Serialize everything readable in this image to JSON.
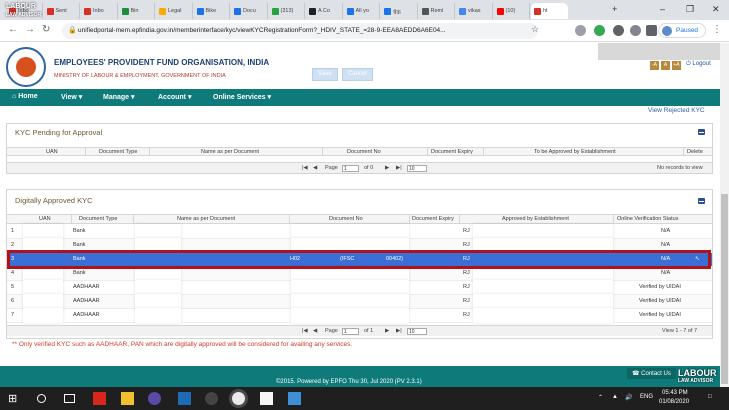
{
  "browser": {
    "tabs": [
      {
        "label": "Inbo",
        "fav": "#d93025"
      },
      {
        "label": "Sent",
        "fav": "#d93025"
      },
      {
        "label": "Inbo",
        "fav": "#d93025"
      },
      {
        "label": "Bin",
        "fav": "#1e8e3e"
      },
      {
        "label": "Legal",
        "fav": "#f9ab00"
      },
      {
        "label": "Bike",
        "fav": "#1a73e8"
      },
      {
        "label": "Docu",
        "fav": "#1a73e8"
      },
      {
        "label": "(313)",
        "fav": "#25a244"
      },
      {
        "label": "A Co",
        "fav": "#202124"
      },
      {
        "label": "All yo",
        "fav": "#1a73e8"
      },
      {
        "label": "चेक",
        "fav": "#1a73e8"
      },
      {
        "label": "Remi",
        "fav": "#555555"
      },
      {
        "label": "vikas",
        "fav": "#4285f4"
      },
      {
        "label": "(10)",
        "fav": "#ff0000"
      },
      {
        "label": "ht",
        "fav": "#d93025"
      }
    ],
    "new_tab": "+",
    "url": "unifiedportal-mem.epfindia.gov.in/memberinterface/kyc/viewKYCRegistrationForm?_HDIV_STATE_=28-9-EEA8AEDD6A6E04...",
    "profile_status": "Paused"
  },
  "header": {
    "org_name": "EMPLOYEES' PROVIDENT FUND ORGANISATION, INDIA",
    "ministry": "MINISTRY OF LABOUR & EMPLOYMENT, GOVERNMENT OF INDIA",
    "ghost_btn_1": "Save",
    "ghost_btn_2": "Cancel",
    "font_sizes": [
      "-A",
      "A",
      "+A"
    ],
    "logout": "Logout"
  },
  "nav": {
    "home": "Home",
    "view": "View",
    "manage": "Manage",
    "account": "Account",
    "online_services": "Online Services"
  },
  "view_rejected": "View Rejected KYC",
  "pending": {
    "title": "KYC Pending for Approval",
    "columns": [
      "UAN",
      "Document Type",
      "Name as per Document",
      "Document No",
      "Document Expiry",
      "To be Approved by Establishment",
      "Delete"
    ],
    "pager": {
      "page_label": "Page",
      "page": "1",
      "of": "of 0",
      "page_size": "10",
      "status": "No records to view"
    }
  },
  "approved": {
    "title": "Digitally Approved KYC",
    "columns": [
      "UAN",
      "Document Type",
      "Name as per Document",
      "Document No",
      "Document Expiry",
      "Approved by Establishment",
      "Online Verification Status"
    ],
    "rows": [
      {
        "n": "1",
        "type": "Bank",
        "doc_prefix": "",
        "doc_mid": "",
        "doc_suffix": "",
        "est": "RJ",
        "status": "N/A"
      },
      {
        "n": "2",
        "type": "Bank",
        "doc_prefix": "",
        "doc_mid": "",
        "doc_suffix": "",
        "est": "RJ",
        "status": "N/A"
      },
      {
        "n": "3",
        "type": "Bank",
        "doc_prefix": "H02",
        "doc_mid": "(IFSC",
        "doc_suffix": "00402)",
        "est": "RJ",
        "status": "N/A"
      },
      {
        "n": "4",
        "type": "Bank",
        "doc_prefix": "",
        "doc_mid": "",
        "doc_suffix": "",
        "est": "RJ",
        "status": "N/A"
      },
      {
        "n": "5",
        "type": "AADHAAR",
        "doc_prefix": "",
        "doc_mid": "",
        "doc_suffix": "",
        "est": "RJ",
        "status": "Verified by UIDAI"
      },
      {
        "n": "6",
        "type": "AADHAAR",
        "doc_prefix": "",
        "doc_mid": "",
        "doc_suffix": "",
        "est": "RJ",
        "status": "Verified by UIDAI"
      },
      {
        "n": "7",
        "type": "AADHAAR",
        "doc_prefix": "",
        "doc_mid": "",
        "doc_suffix": "",
        "est": "RJ",
        "status": "Verified by UIDAI"
      }
    ],
    "pager": {
      "page_label": "Page",
      "page": "1",
      "of": "of 1",
      "page_size": "10",
      "status": "View 1 - 7 of 7"
    }
  },
  "note": "** Only verified KYC such as AADHAAR, PAN which are digitally approved will be considered for availing any services.",
  "footer": {
    "contact": "Contact Us",
    "copyright": "©2015. Powered by EPFO Thu 30, Jul 2020 (PV 2.3.1)"
  },
  "taskbar": {
    "lang": "ENG",
    "time": "05:43 PM",
    "date": "01/08/2020"
  },
  "watermark": {
    "line1": "LABOUR",
    "line2": "LAW ADVISOR"
  }
}
